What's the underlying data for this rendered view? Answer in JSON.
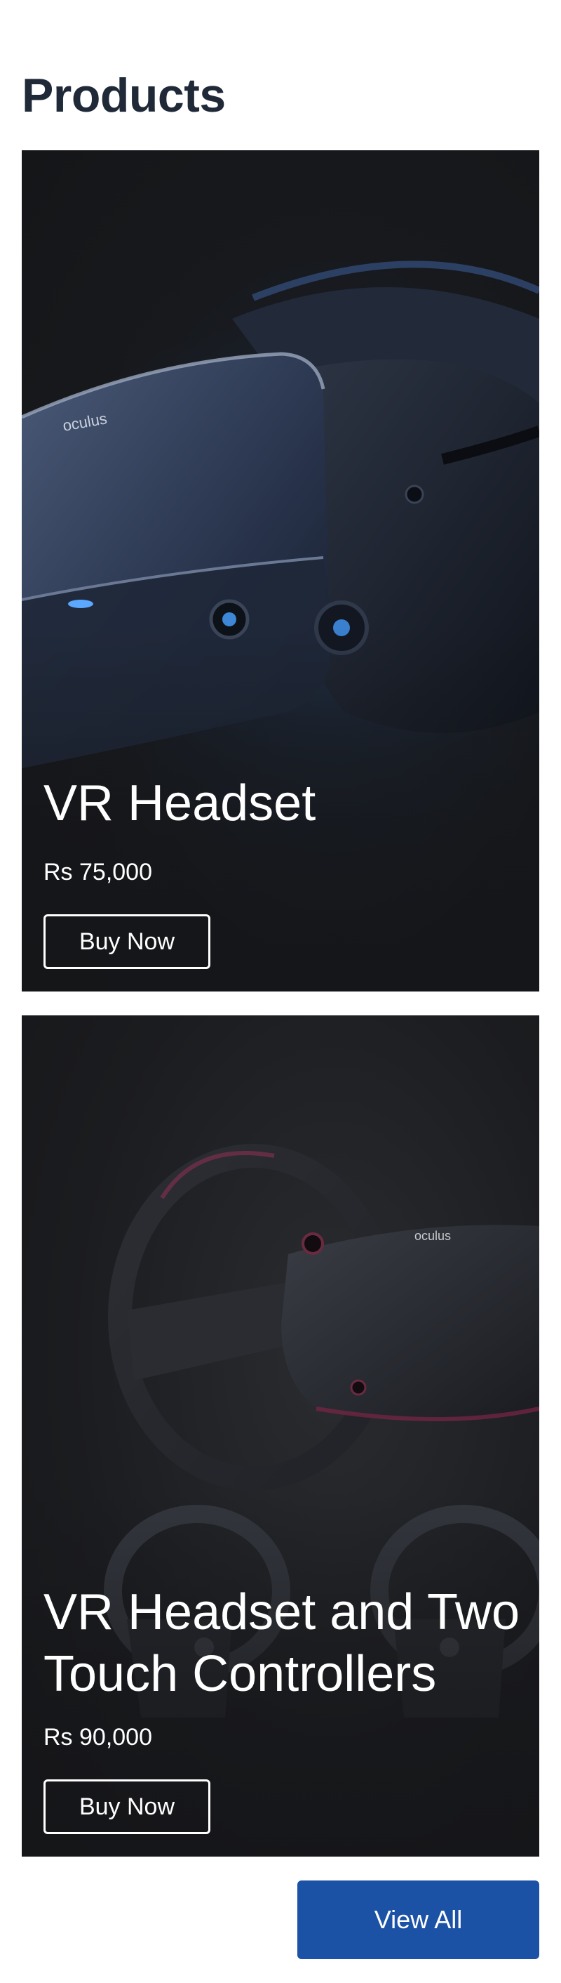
{
  "page": {
    "title": "Products"
  },
  "products": [
    {
      "name": "VR Headset",
      "price": "Rs 75,000",
      "button_label": "Buy Now",
      "brand_mark": "oculus"
    },
    {
      "name": "VR Headset and Two Touch Controllers",
      "price": "Rs 90,000",
      "button_label": "Buy Now",
      "brand_mark": "oculus"
    }
  ],
  "footer": {
    "view_all_label": "View All"
  },
  "colors": {
    "title": "#1f2937",
    "card_background": "#17191d",
    "accent_button": "#1c52a6",
    "text_on_card": "#ffffff"
  }
}
